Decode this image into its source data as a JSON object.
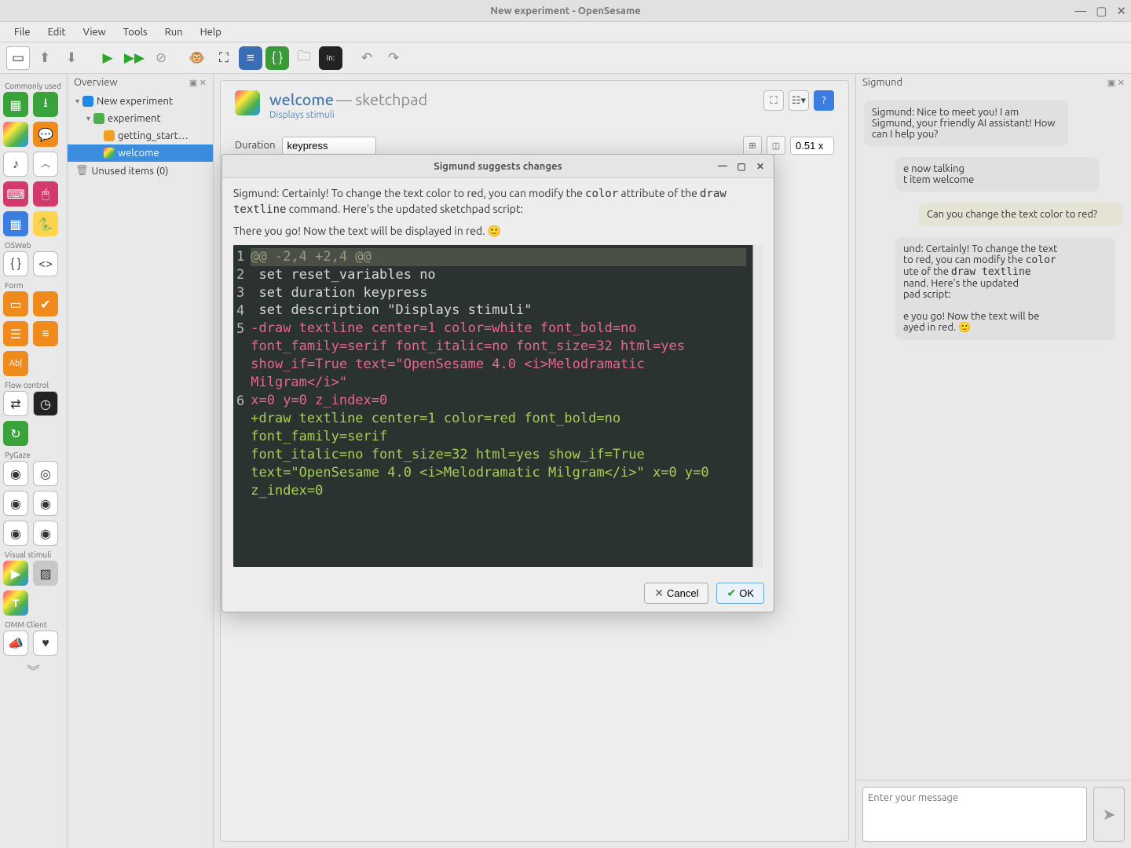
{
  "window": {
    "title": "New experiment - OpenSesame"
  },
  "menubar": [
    "File",
    "Edit",
    "View",
    "Tools",
    "Run",
    "Help"
  ],
  "overview": {
    "title": "Overview",
    "nodes": {
      "root": "New experiment",
      "seq": "experiment",
      "getting": "getting_start…",
      "welcome": "welcome",
      "unused": "Unused items (0)"
    }
  },
  "editor": {
    "tab_name": "welcome",
    "tab_type": "sketchpad",
    "tab_sep": "—",
    "subtitle": "Displays stimuli",
    "duration_label": "Duration",
    "duration_value": "keypress",
    "zoom": "0.51 x"
  },
  "sigmund_panel": {
    "title": "Sigmund",
    "msg1": "Sigmund: Nice to meet you! I am Sigmund, your friendly AI assistant! How can I help you?",
    "msg2_a": "e now talking",
    "msg2_b": "t item welcome",
    "user1": "Can you change the text color to red?",
    "msg3_a": "und: Certainly! To change the text",
    "msg3_b": " to red, you can modify the ",
    "msg3_c": "color",
    "msg3_d": "ute of the ",
    "msg3_e": "draw textline",
    "msg3_f": "nand. Here's the updated",
    "msg3_g": "pad script:",
    "msg3_h": "e you go! Now the text will be",
    "msg3_i": "ayed in red. 🙂",
    "input_placeholder": "Enter your message"
  },
  "modal": {
    "title": "Sigmund suggests changes",
    "intro_a": "Sigmund: Certainly! To change the text color to red, you can modify the ",
    "intro_b": "color",
    "intro_c": " attribute of the ",
    "intro_d": "draw textline",
    "intro_e": " command. Here's the updated sketchpad script:",
    "outro": "There you go! Now the text will be displayed in red. 🙂",
    "gutter": [
      "1",
      "2",
      "3",
      "4",
      "5",
      " ",
      " ",
      " ",
      "6",
      " ",
      " ",
      " "
    ],
    "diff_lines": [
      {
        "cls": "hunk",
        "t": "@@ -2,4 +2,4 @@"
      },
      {
        "cls": "ctx",
        "t": " set reset_variables no"
      },
      {
        "cls": "ctx",
        "t": " set duration keypress"
      },
      {
        "cls": "ctx",
        "t": " set description \"Displays stimuli\""
      },
      {
        "cls": "del",
        "t": "-draw textline center=1 color=white font_bold=no"
      },
      {
        "cls": "del",
        "t": "font_family=serif font_italic=no font_size=32 html=yes"
      },
      {
        "cls": "del",
        "t": "show_if=True text=\"OpenSesame 4.0 <i>Melodramatic Milgram</i>\""
      },
      {
        "cls": "del",
        "t": "x=0 y=0 z_index=0"
      },
      {
        "cls": "add",
        "t": "+draw textline center=1 color=red font_bold=no font_family=serif"
      },
      {
        "cls": "add",
        "t": "font_italic=no font_size=32 html=yes show_if=True"
      },
      {
        "cls": "add",
        "t": "text=\"OpenSesame 4.0 <i>Melodramatic Milgram</i>\" x=0 y=0"
      },
      {
        "cls": "add",
        "t": "z_index=0"
      }
    ],
    "cancel": "Cancel",
    "ok": "OK"
  },
  "palette": {
    "g1": "Commonly used",
    "g2": "OSWeb",
    "g3": "Form",
    "g4": "Flow control",
    "g5": "PyGaze",
    "g6": "Visual stimuli",
    "g7": "OMM Client"
  }
}
